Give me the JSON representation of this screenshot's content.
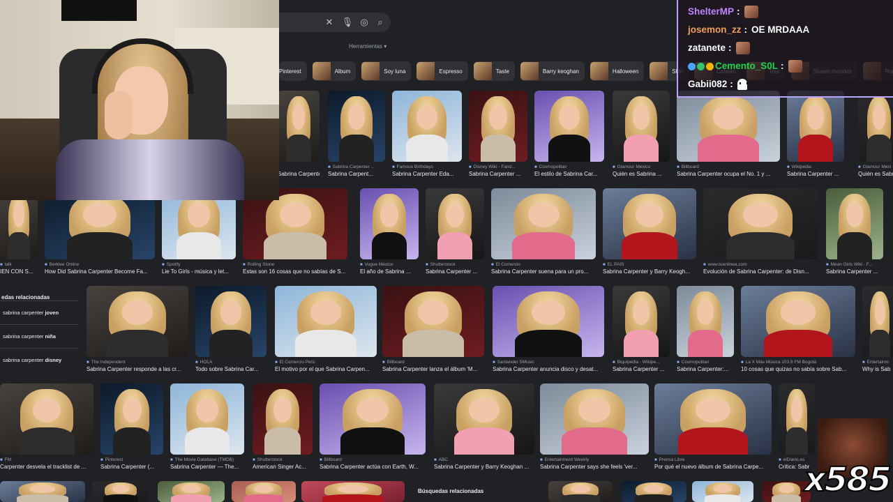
{
  "search": {
    "tools_label": "Herramientas",
    "clear_icon": "close-icon",
    "mic_icon": "mic-icon",
    "lens_icon": "lens-icon",
    "search_icon": "search-icon"
  },
  "chips": [
    {
      "label": "Pinterest",
      "thumb": false
    },
    {
      "label": "Album",
      "thumb": true
    },
    {
      "label": "Soy luna",
      "thumb": true
    },
    {
      "label": "Espresso",
      "thumb": true
    },
    {
      "label": "Taste",
      "thumb": true
    },
    {
      "label": "Barry keoghan",
      "thumb": true
    },
    {
      "label": "Halloween",
      "thumb": true
    },
    {
      "label": "Skin",
      "thumb": true
    },
    {
      "label": "Cabello",
      "thumb": true
    },
    {
      "label": "Tour",
      "thumb": true
    },
    {
      "label": "Shawn mendes",
      "thumb": true
    },
    {
      "label": "Ropa",
      "thumb": true
    }
  ],
  "row1": [
    {
      "source": "",
      "caption": "Sabrina Carpente..."
    },
    {
      "source": "Sabrina Carpenter ...",
      "caption": "Sabrina Carpent..."
    },
    {
      "source": "Famous Birthdays",
      "caption": "Sabrina Carpenter Eda..."
    },
    {
      "source": "Disney Wiki - Fand...",
      "caption": "Sabrina Carpenter ..."
    },
    {
      "source": "Cosmopolitan",
      "caption": "El estilo de Sabrina Car..."
    },
    {
      "source": "Glamour México",
      "caption": "Quién es Sabrina ..."
    },
    {
      "source": "Billboard",
      "caption": "Sabrina Carpenter ocupa el No. 1 y ..."
    },
    {
      "source": "Wikipedia",
      "caption": "Sabrina Carpenter ..."
    },
    {
      "source": "Glamour Méxi",
      "caption": "Quién es Sabr"
    }
  ],
  "row2": [
    {
      "source": "talk",
      "caption": "IEN CON S..."
    },
    {
      "source": "Berklee Online",
      "caption": "How Did Sabrina Carpenter Become Fa..."
    },
    {
      "source": "Spotify",
      "caption": "Lie To Girls - música y let..."
    },
    {
      "source": "Rolling Stone",
      "caption": "Estas son 16 cosas que no sabías de S..."
    },
    {
      "source": "Vogue México",
      "caption": "El año de Sabrina ..."
    },
    {
      "source": "Shutterstock",
      "caption": "Sabrina Carpenter ..."
    },
    {
      "source": "El Comercio",
      "caption": "Sabrina Carpenter suena para un pro..."
    },
    {
      "source": "EL PAÍS",
      "caption": "Sabrina Carpenter y Barry Keogh..."
    },
    {
      "source": "www.tuenlinea.com",
      "caption": "Evolución de Sabrina Carpenter: de Disn..."
    },
    {
      "source": "Mean Girls Wiki - F...",
      "caption": "Sabrina Carpenter ..."
    }
  ],
  "related": {
    "title": "edas relacionadas",
    "items": [
      {
        "base": "sabrina carpenter ",
        "bold": "joven"
      },
      {
        "base": "sabrina carpenter ",
        "bold": "niña"
      },
      {
        "base": "sabrina carpenter ",
        "bold": "disney"
      }
    ]
  },
  "row3": [
    {
      "source": "The Independent",
      "caption": "Sabrina Carpenter responde a las cr..."
    },
    {
      "source": "HOLA",
      "caption": "Todo sobre Sabrina Car..."
    },
    {
      "source": "El Comercio Perú",
      "caption": "El motivo por el que Sabrina Carpen..."
    },
    {
      "source": "Billboard",
      "caption": "Sabrina Carpenter lanza el álbum 'M..."
    },
    {
      "source": "Santander SMusic",
      "caption": "Sabrina Carpenter anuncia disco y desat..."
    },
    {
      "source": "Biquipedia - Wikipe...",
      "caption": "Sabrina Carpenter ..."
    },
    {
      "source": "Cosmopolitan",
      "caption": "Sabrina Carpenter:..."
    },
    {
      "source": "La X Más Música 103.9 FM Bogotá",
      "caption": "10 cosas que quizas no sabía sobre Sab..."
    },
    {
      "source": "Entertainm",
      "caption": "Why is Sab"
    }
  ],
  "row4": [
    {
      "source": "FM",
      "caption": "Carpenter desvela el tracklist de ..."
    },
    {
      "source": "Pinterest",
      "caption": "Sabrina Carpenter (..."
    },
    {
      "source": "The Movie Database (TMDB)",
      "caption": "Sabrina Carpenter — The..."
    },
    {
      "source": "Shutterstock",
      "caption": "American Singer Ac..."
    },
    {
      "source": "Billboard",
      "caption": "Sabrina Carpenter actúa con Earth, W..."
    },
    {
      "source": "ABC",
      "caption": "Sabrina Carpenter y Barry Keoghan ..."
    },
    {
      "source": "Entertainment Weekly",
      "caption": "Sabrina Carpenter says she feels 'ver..."
    },
    {
      "source": "Prensa Libre",
      "caption": "Por qué el nuevo álbum de Sabrina Carpe..."
    },
    {
      "source": "elDiario.es",
      "caption": "Crítica: Sabr"
    }
  ],
  "related2": {
    "title": "Búsquedas relacionadas"
  },
  "chat": [
    {
      "user": "ShelterMP",
      "color": "#c084fc",
      "text": "",
      "emote": true
    },
    {
      "user": "josemon_zz",
      "color": "#f0a05a",
      "text": "OE MRDAAA",
      "emote": false
    },
    {
      "user": "zatanete",
      "color": "#ffffff",
      "text": "",
      "emote": true
    },
    {
      "user": "Cemento_S0L",
      "color": "#22d34a",
      "text": "",
      "emote": true
    },
    {
      "user": "Gabii082",
      "color": "#ffffff",
      "text": "",
      "emote": false,
      "ghost": true
    }
  ],
  "combo": {
    "count": "x585"
  }
}
